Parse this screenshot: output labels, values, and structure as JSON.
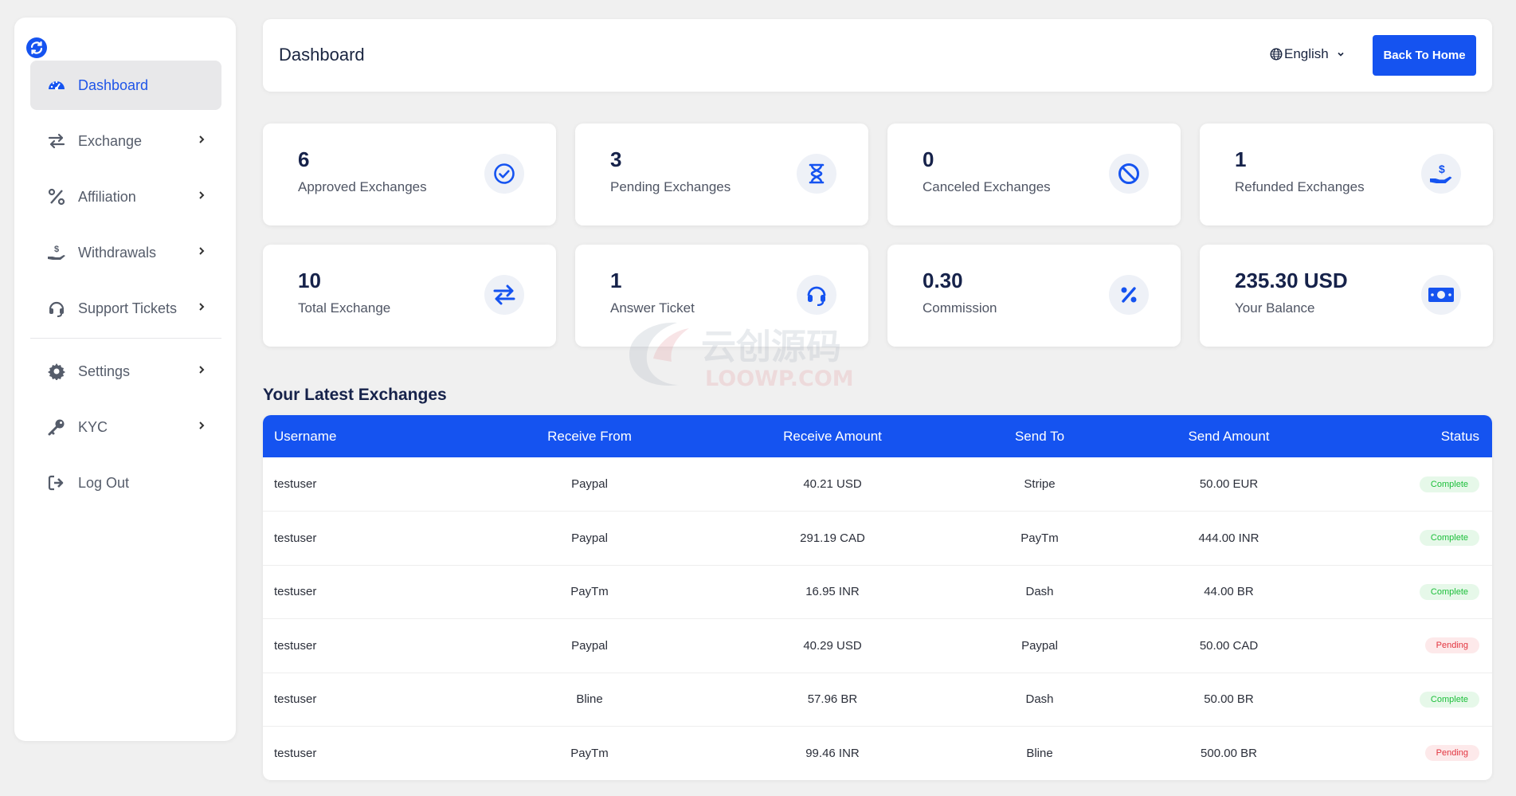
{
  "sidebar": {
    "logo_icon": "refresh-logo-icon",
    "items": [
      {
        "label": "Dashboard",
        "icon": "gauge-icon",
        "active": true
      },
      {
        "label": "Exchange",
        "icon": "arrows-exchange-icon"
      },
      {
        "label": "Affiliation",
        "icon": "percent-icon"
      },
      {
        "label": "Withdrawals",
        "icon": "hand-dollar-icon"
      },
      {
        "label": "Support Tickets",
        "icon": "headset-icon"
      },
      {
        "label": "Settings",
        "icon": "gear-icon"
      },
      {
        "label": "KYC",
        "icon": "key-icon"
      },
      {
        "label": "Log Out",
        "icon": "logout-icon"
      }
    ]
  },
  "header": {
    "title": "Dashboard",
    "language": "English",
    "back_button": "Back To Home"
  },
  "stats": [
    {
      "value": "6",
      "label": "Approved Exchanges",
      "icon": "check-circle-icon"
    },
    {
      "value": "3",
      "label": "Pending Exchanges",
      "icon": "hourglass-icon"
    },
    {
      "value": "0",
      "label": "Canceled Exchanges",
      "icon": "ban-icon"
    },
    {
      "value": "1",
      "label": "Refunded Exchanges",
      "icon": "hand-dollar-icon"
    },
    {
      "value": "10",
      "label": "Total Exchange",
      "icon": "arrows-exchange-icon"
    },
    {
      "value": "1",
      "label": "Answer Ticket",
      "icon": "headset-icon"
    },
    {
      "value": "0.30",
      "label": "Commission",
      "icon": "percent-icon"
    },
    {
      "value": "235.30 USD",
      "label": "Your Balance",
      "icon": "money-bill-icon"
    }
  ],
  "table": {
    "title": "Your Latest Exchanges",
    "headers": [
      "Username",
      "Receive From",
      "Receive Amount",
      "Send To",
      "Send Amount",
      "Status"
    ],
    "rows": [
      [
        "testuser",
        "Paypal",
        "40.21 USD",
        "Stripe",
        "50.00 EUR",
        "Complete"
      ],
      [
        "testuser",
        "Paypal",
        "291.19 CAD",
        "PayTm",
        "444.00 INR",
        "Complete"
      ],
      [
        "testuser",
        "PayTm",
        "16.95 INR",
        "Dash",
        "44.00 BR",
        "Complete"
      ],
      [
        "testuser",
        "Paypal",
        "40.29 USD",
        "Paypal",
        "50.00 CAD",
        "Pending"
      ],
      [
        "testuser",
        "Bline",
        "57.96 BR",
        "Dash",
        "50.00 BR",
        "Complete"
      ],
      [
        "testuser",
        "PayTm",
        "99.46 INR",
        "Bline",
        "500.00 BR",
        "Pending"
      ]
    ]
  },
  "watermark": {
    "line1": "云创源码",
    "line2": "LOOWP.COM"
  },
  "colors": {
    "accent": "#1553f0",
    "complete": "#1cbf3a",
    "pending": "#e2343f"
  }
}
